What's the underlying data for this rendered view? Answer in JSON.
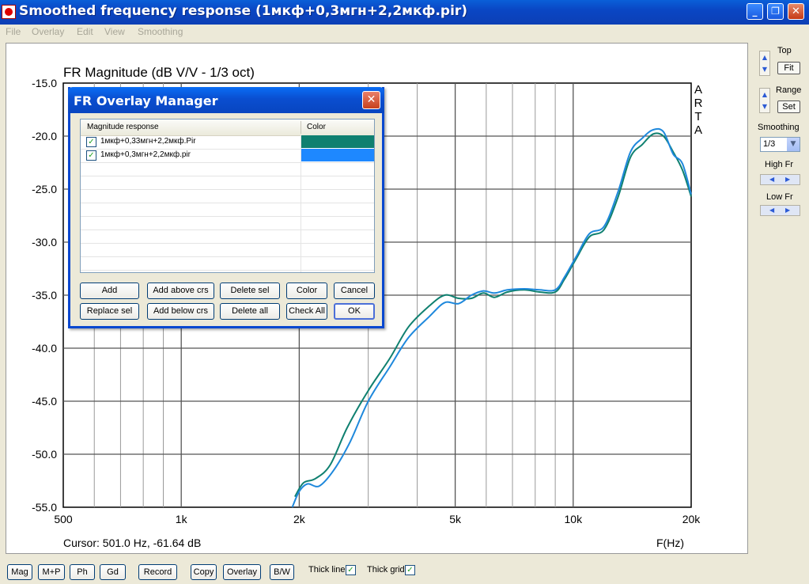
{
  "window": {
    "title": "Smoothed frequency response (1мкф+0,3мгн+2,2мкф.pir)",
    "minimize": "_",
    "maximize": "❐",
    "close": "✕"
  },
  "menu": [
    "File",
    "Overlay",
    "Edit",
    "View",
    "Smoothing"
  ],
  "chart_data": {
    "type": "line",
    "title": "FR Magnitude (dB V/V - 1/3 oct)",
    "xlabel": "F(Hz)",
    "ylabel": "",
    "x_scale": "log",
    "xlim": [
      500,
      20000
    ],
    "ylim": [
      -55,
      -15
    ],
    "x_ticks": [
      500,
      1000,
      2000,
      5000,
      10000,
      20000
    ],
    "x_tick_labels": [
      "500",
      "1k",
      "2k",
      "5k",
      "10k",
      "20k"
    ],
    "y_ticks": [
      -55,
      -50,
      -45,
      -40,
      -35,
      -30,
      -25,
      -20,
      -15
    ],
    "y_tick_labels": [
      "-55.0",
      "-50.0",
      "-45.0",
      "-40.0",
      "-35.0",
      "-30.0",
      "-25.0",
      "-20.0",
      "-15.0"
    ],
    "grid": true,
    "watermark": "ARTA",
    "series": [
      {
        "name": "1мкф+0,33мгн+2,2мкф.Pir",
        "color": "#0f8070",
        "x": [
          1950,
          2050,
          2200,
          2400,
          2650,
          3000,
          3400,
          3800,
          4300,
          4700,
          5100,
          5500,
          5900,
          6300,
          6800,
          7500,
          8200,
          9000,
          9500,
          10200,
          11000,
          12000,
          13000,
          14000,
          15000,
          16000,
          17000,
          18000,
          19000,
          20000
        ],
        "y": [
          -54.0,
          -52.7,
          -52.3,
          -51.0,
          -47.5,
          -44.0,
          -41.0,
          -38.0,
          -36.0,
          -35.0,
          -35.3,
          -35.3,
          -34.8,
          -35.2,
          -34.7,
          -34.5,
          -34.7,
          -34.7,
          -33.5,
          -31.5,
          -29.5,
          -28.8,
          -25.8,
          -22.0,
          -20.8,
          -19.8,
          -20.0,
          -21.5,
          -23.2,
          -25.7
        ]
      },
      {
        "name": "1мкф+0,3мгн+2,2мкф.pir",
        "color": "#1e88dc",
        "x": [
          1920,
          2000,
          2100,
          2250,
          2450,
          2700,
          3000,
          3400,
          3800,
          4300,
          4700,
          5100,
          5500,
          5900,
          6300,
          6800,
          7500,
          8200,
          9000,
          9500,
          10200,
          11000,
          12000,
          13000,
          14000,
          15000,
          16000,
          17000,
          18000,
          19000,
          20000
        ],
        "y": [
          -55.0,
          -53.5,
          -52.8,
          -53.0,
          -51.5,
          -48.8,
          -45.0,
          -41.8,
          -39.0,
          -37.0,
          -35.7,
          -35.8,
          -35.0,
          -34.6,
          -34.8,
          -34.5,
          -34.4,
          -34.5,
          -34.5,
          -33.3,
          -31.3,
          -29.2,
          -28.5,
          -25.3,
          -21.5,
          -20.2,
          -19.4,
          -19.6,
          -21.7,
          -22.6,
          -25.5
        ]
      }
    ]
  },
  "cursor_text": "Cursor: 501.0 Hz, -61.64 dB",
  "side": {
    "top_label": "Top",
    "fit_btn": "Fit",
    "range_label": "Range",
    "set_btn": "Set",
    "smoothing_label": "Smoothing",
    "smoothing_value": "1/3",
    "highfr_label": "High Fr",
    "lowfr_label": "Low Fr"
  },
  "toolbar": {
    "mag": "Mag",
    "mp": "M+P",
    "ph": "Ph",
    "gd": "Gd",
    "record": "Record",
    "copy": "Copy",
    "overlay": "Overlay",
    "bw": "B/W",
    "thick_line": "Thick line",
    "thick_grid": "Thick grid"
  },
  "dialog": {
    "title": "FR Overlay Manager",
    "col_magnitude": "Magnitude response",
    "col_color": "Color",
    "rows": [
      {
        "label": "1мкф+0,33мгн+2,2мкф.Pir",
        "color": "#0f8070",
        "checked": true
      },
      {
        "label": "1мкф+0,3мгн+2,2мкф.pir",
        "color": "#1e88ff",
        "checked": true
      }
    ],
    "buttons": {
      "add": "Add",
      "add_above": "Add above crs",
      "delete_sel": "Delete sel",
      "color": "Color",
      "cancel": "Cancel",
      "replace_sel": "Replace sel",
      "add_below": "Add below crs",
      "delete_all": "Delete all",
      "check_all": "Check All",
      "ok": "OK"
    }
  }
}
